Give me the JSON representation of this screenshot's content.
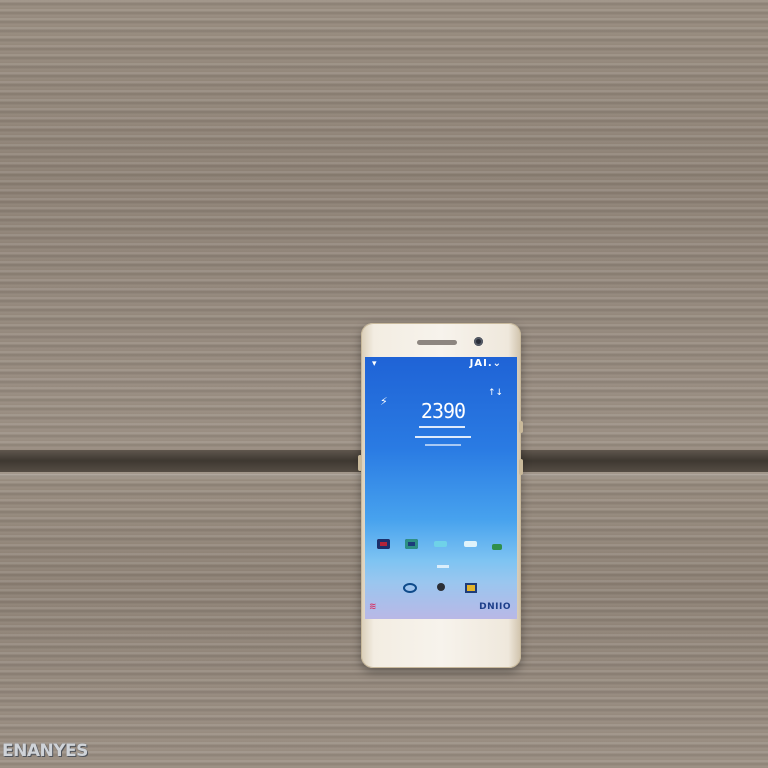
{
  "phone": {
    "status_text": "JAI.⌄",
    "wifi_icon": "▾",
    "signal_icon": "⌄",
    "widget_left_icon": "⚡",
    "widget_right_icon": "↑↓",
    "clock": "2390",
    "bottom_label": "DNIIO",
    "bottom_left_mark": "≋"
  },
  "colors": {
    "screen_top": "#1f63d6",
    "screen_bottom": "#b9b8e6",
    "phone_body": "#f3ede2"
  },
  "watermark": "ENANYES"
}
